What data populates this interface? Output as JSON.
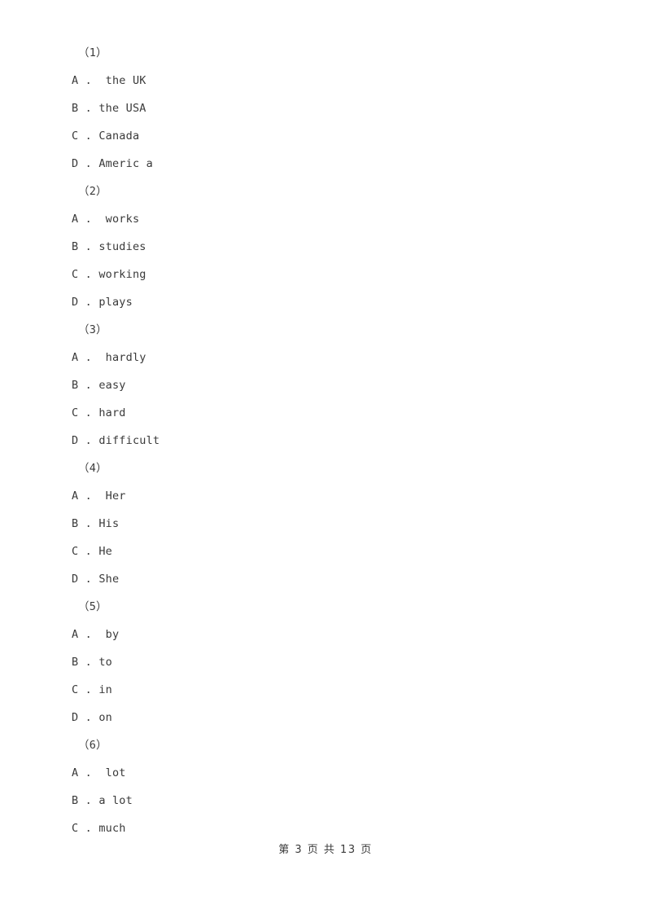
{
  "document": {
    "groups": [
      {
        "label": "（1）",
        "options": [
          {
            "letter": "A",
            "separator": " .  ",
            "text": "the UK"
          },
          {
            "letter": "B",
            "separator": " . ",
            "text": "the USA"
          },
          {
            "letter": "C",
            "separator": " . ",
            "text": "Canada"
          },
          {
            "letter": "D",
            "separator": " . ",
            "text": "Americ a"
          }
        ]
      },
      {
        "label": "（2）",
        "options": [
          {
            "letter": "A",
            "separator": " .  ",
            "text": "works"
          },
          {
            "letter": "B",
            "separator": " . ",
            "text": "studies"
          },
          {
            "letter": "C",
            "separator": " . ",
            "text": "working"
          },
          {
            "letter": "D",
            "separator": " . ",
            "text": "plays"
          }
        ]
      },
      {
        "label": "（3）",
        "options": [
          {
            "letter": "A",
            "separator": " .  ",
            "text": "hardly"
          },
          {
            "letter": "B",
            "separator": " . ",
            "text": "easy"
          },
          {
            "letter": "C",
            "separator": " . ",
            "text": "hard"
          },
          {
            "letter": "D",
            "separator": " . ",
            "text": "difficult"
          }
        ]
      },
      {
        "label": "（4）",
        "options": [
          {
            "letter": "A",
            "separator": " .  ",
            "text": "Her"
          },
          {
            "letter": "B",
            "separator": " . ",
            "text": "His"
          },
          {
            "letter": "C",
            "separator": " . ",
            "text": "He"
          },
          {
            "letter": "D",
            "separator": " . ",
            "text": "She"
          }
        ]
      },
      {
        "label": "（5）",
        "options": [
          {
            "letter": "A",
            "separator": " .  ",
            "text": "by"
          },
          {
            "letter": "B",
            "separator": " . ",
            "text": "to"
          },
          {
            "letter": "C",
            "separator": " . ",
            "text": "in"
          },
          {
            "letter": "D",
            "separator": " . ",
            "text": "on"
          }
        ]
      },
      {
        "label": "（6）",
        "options": [
          {
            "letter": "A",
            "separator": " .  ",
            "text": "lot"
          },
          {
            "letter": "B",
            "separator": " . ",
            "text": "a lot"
          },
          {
            "letter": "C",
            "separator": " . ",
            "text": "much"
          }
        ]
      }
    ]
  },
  "footer": {
    "page_indicator": "第 3 页 共 13 页",
    "current_page": "3",
    "total_pages": "13"
  },
  "colors": {
    "text": "#3a3a3a",
    "background": "#ffffff"
  }
}
